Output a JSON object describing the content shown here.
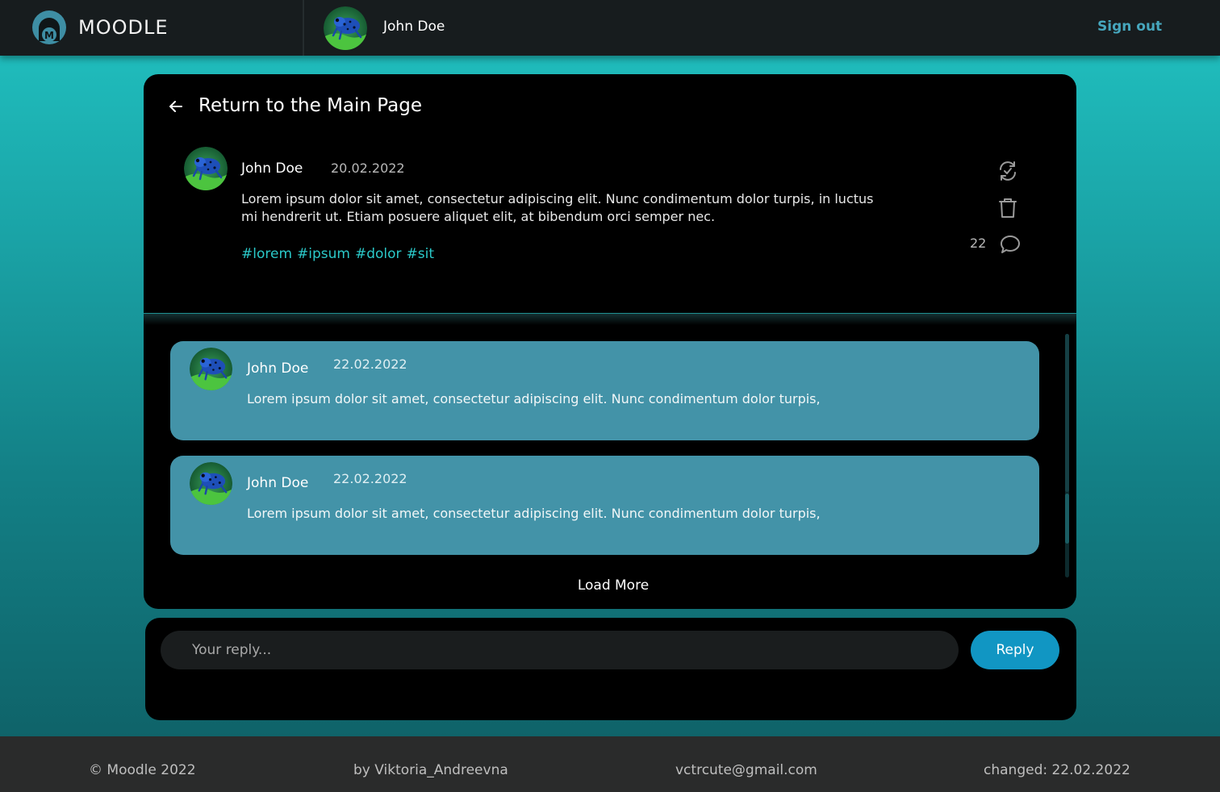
{
  "header": {
    "brand": "MOODLE",
    "user_name": "John Doe",
    "sign_out": "Sign out"
  },
  "post": {
    "back_label": "Return to the Main Page",
    "author": "John Doe",
    "date": "20.02.2022",
    "body": "Lorem ipsum dolor sit amet, consectetur adipiscing elit. Nunc condimentum dolor turpis, in luctus mi hendrerit ut. Etiam posuere aliquet elit, at bibendum orci semper nec.",
    "tags": [
      "#lorem",
      "#ipsum",
      "#dolor",
      "#sit"
    ],
    "comment_count": "22"
  },
  "replies": [
    {
      "author": "John Doe",
      "date": "22.02.2022",
      "body": "Lorem ipsum dolor sit amet, consectetur adipiscing elit. Nunc condimentum dolor turpis,"
    },
    {
      "author": "John Doe",
      "date": "22.02.2022",
      "body": "Lorem ipsum dolor sit amet, consectetur adipiscing elit. Nunc condimentum dolor turpis,"
    }
  ],
  "load_more": "Load More",
  "reply_form": {
    "placeholder": "Your reply...",
    "button": "Reply"
  },
  "footer": {
    "copyright": "© Moodle 2022",
    "author": "by Viktoria_Andreevna",
    "email": "vctrcute@gmail.com",
    "changed": "changed: 22.02.2022"
  },
  "icons": {
    "logo": "moodle-logo-icon",
    "back": "arrow-left-icon",
    "repost": "repost-icon",
    "delete": "trash-icon",
    "comment": "comment-icon"
  },
  "colors": {
    "accent": "#46a6bd",
    "tag": "#2bc9c9",
    "reply_bg": "#4393a8",
    "button": "#1196c3"
  }
}
